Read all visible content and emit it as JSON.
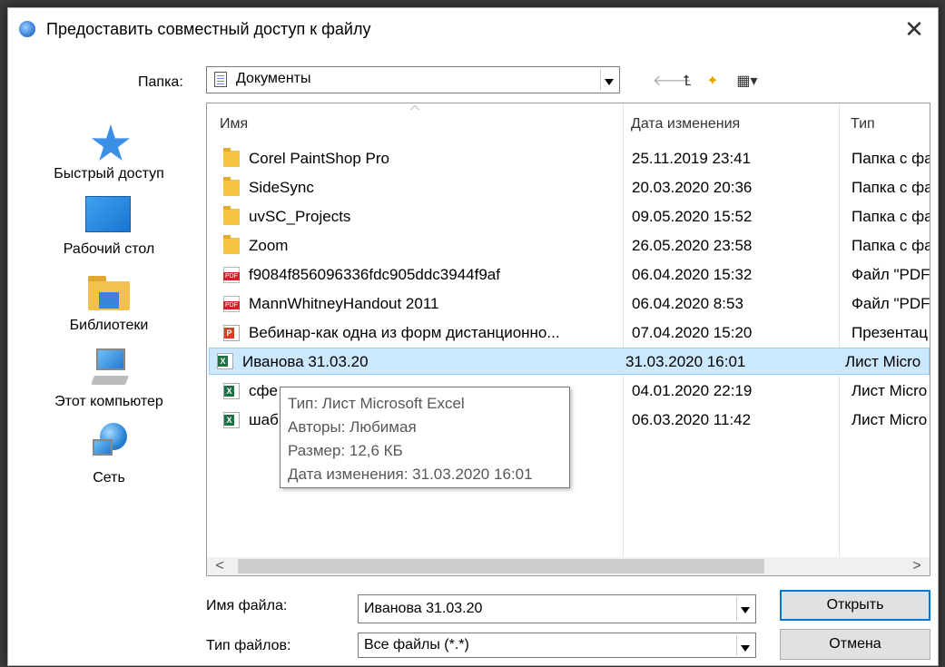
{
  "window": {
    "title": "Предоставить совместный доступ к файлу",
    "close_glyph": "✕"
  },
  "folder": {
    "label": "Папка:",
    "value": "Документы"
  },
  "toolbar": {
    "back_glyph": "🡐",
    "up_glyph": "⮤",
    "new_folder_glyph": "✦",
    "view_glyph": "▦▾"
  },
  "places": [
    {
      "label": "Быстрый доступ",
      "icon": "star-icon"
    },
    {
      "label": "Рабочий стол",
      "icon": "desktop-icon"
    },
    {
      "label": "Библиотеки",
      "icon": "libraries-icon"
    },
    {
      "label": "Этот компьютер",
      "icon": "computer-icon"
    },
    {
      "label": "Сеть",
      "icon": "network-icon"
    }
  ],
  "columns": {
    "name": "Имя",
    "date": "Дата изменения",
    "type": "Тип"
  },
  "files": [
    {
      "name": "Corel PaintShop Pro",
      "date": "25.11.2019 23:41",
      "type": "Папка с фа",
      "icon": "folder"
    },
    {
      "name": "SideSync",
      "date": "20.03.2020 20:36",
      "type": "Папка с фа",
      "icon": "folder"
    },
    {
      "name": "uvSC_Projects",
      "date": "09.05.2020 15:52",
      "type": "Папка с фа",
      "icon": "folder"
    },
    {
      "name": "Zoom",
      "date": "26.05.2020 23:58",
      "type": "Папка с фа",
      "icon": "folder"
    },
    {
      "name": "f9084f856096336fdc905ddc3944f9af",
      "date": "06.04.2020 15:32",
      "type": "Файл \"PDF'",
      "icon": "pdf"
    },
    {
      "name": "MannWhitneyHandout 2011",
      "date": "06.04.2020 8:53",
      "type": "Файл \"PDF'",
      "icon": "pdf"
    },
    {
      "name": "Вебинар-как одна из форм дистанционно...",
      "date": "07.04.2020 15:20",
      "type": "Презентац",
      "icon": "ppt"
    },
    {
      "name": "Иванова 31.03.20",
      "date": "31.03.2020 16:01",
      "type": "Лист Micro",
      "icon": "xls",
      "selected": true
    },
    {
      "name": "сфе",
      "date": "04.01.2020 22:19",
      "type": "Лист Micro",
      "icon": "xls"
    },
    {
      "name": "шаб",
      "date": "06.03.2020 11:42",
      "type": "Лист Micro",
      "icon": "xls"
    }
  ],
  "tooltip": {
    "type": "Тип: Лист Microsoft Excel",
    "authors": "Авторы: Любимая",
    "size": "Размер: 12,6 КБ",
    "modified": "Дата изменения: 31.03.2020 16:01"
  },
  "scroll": {
    "left_glyph": "<",
    "right_glyph": ">"
  },
  "filename": {
    "label": "Имя файла:",
    "value": "Иванова 31.03.20"
  },
  "filetype": {
    "label": "Тип файлов:",
    "value": "Все файлы (*.*)"
  },
  "buttons": {
    "open": "Открыть",
    "cancel": "Отмена"
  }
}
